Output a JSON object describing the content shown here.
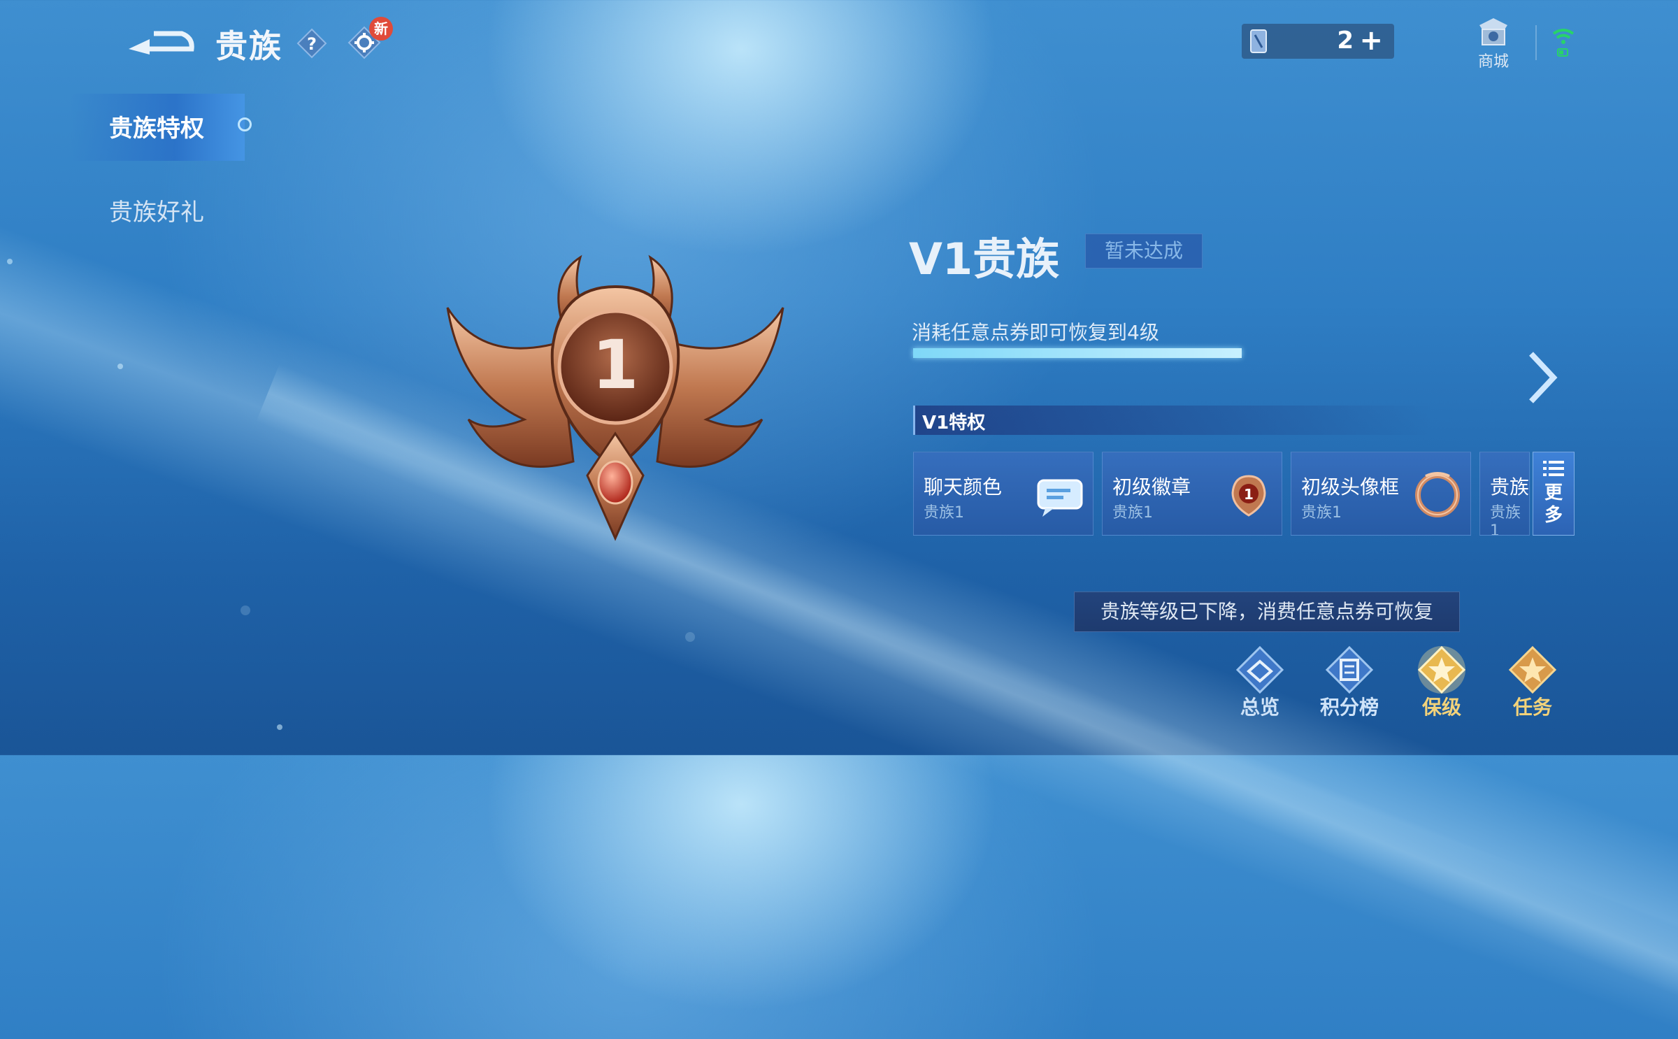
{
  "header": {
    "title": "贵族",
    "new_badge": "新",
    "currency_amount": "2",
    "currency_plus": "+",
    "shop_label": "商城"
  },
  "sidebar": {
    "items": [
      {
        "label": "贵族特权",
        "active": true
      },
      {
        "label": "贵族好礼",
        "active": false
      }
    ]
  },
  "level": {
    "emblem_number": "1",
    "title": "V1贵族",
    "status_badge": "暂未达成",
    "progress_text": "消耗任意点券即可恢复到4级",
    "progress_fraction": 1.0
  },
  "privileges": {
    "header": "V1特权",
    "cards": [
      {
        "name": "聊天颜色",
        "sub": "贵族1",
        "icon": "chat-bubble-icon"
      },
      {
        "name": "初级徽章",
        "sub": "贵族1",
        "icon": "badge-icon"
      },
      {
        "name": "初级头像框",
        "sub": "贵族1",
        "icon": "avatar-frame-icon"
      },
      {
        "name": "贵族",
        "sub": "贵族1",
        "icon": ""
      }
    ],
    "more_label": "更多"
  },
  "toast": "贵族等级已下降，消费任意点券可恢复",
  "bottom_nav": [
    {
      "label": "总览",
      "color": "#cfe3f8",
      "icon": "overview-icon"
    },
    {
      "label": "积分榜",
      "color": "#cfe3f8",
      "icon": "leaderboard-icon"
    },
    {
      "label": "保级",
      "color": "#f2d27a",
      "icon": "keep-level-icon"
    },
    {
      "label": "任务",
      "color": "#f2d27a",
      "icon": "task-icon"
    }
  ],
  "colors": {
    "accent_gold": "#f2d27a",
    "progress": "#7fd8f8",
    "emblem_bronze": "#c07850"
  }
}
